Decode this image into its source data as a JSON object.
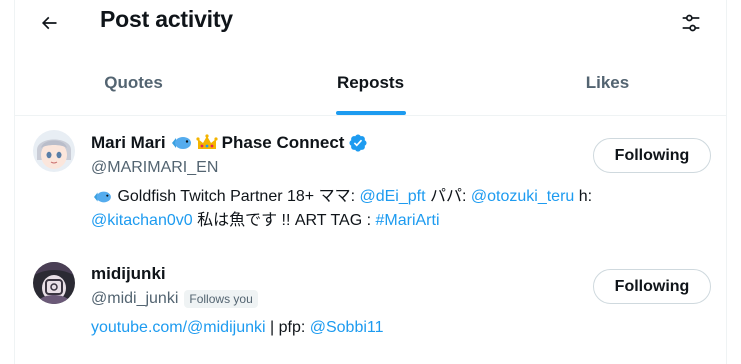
{
  "header": {
    "title": "Post activity",
    "back_icon": "arrow-left-icon",
    "filter_icon": "sliders-icon"
  },
  "tabs": [
    {
      "label": "Quotes",
      "active": false
    },
    {
      "label": "Reposts",
      "active": true
    },
    {
      "label": "Likes",
      "active": false
    }
  ],
  "users": [
    {
      "name": "Mari Mari",
      "name_suffix": "Phase Connect",
      "name_emojis": [
        "fish-emoji",
        "crown-emoji"
      ],
      "verified": true,
      "handle": "@MARIMARI_EN",
      "follow_label": "Following",
      "bio": {
        "t1": " Goldfish Twitch Partner 18+ ママ: ",
        "l1": "@dEi_pft",
        "t2": " パパ: ",
        "l2": "@otozuki_teru",
        "t3": " h:",
        "l3": "@kitachan0v0",
        "t4": " 私は魚です !! ART TAG : ",
        "l4": "#MariArti"
      }
    },
    {
      "name": "midijunki",
      "handle": "@midi_junki",
      "follows_you": "Follows you",
      "follow_label": "Following",
      "bio": {
        "l1": "youtube.com/@midijunki",
        "t1": " | pfp: ",
        "l2": "@Sobbi11"
      }
    }
  ],
  "colors": {
    "accent": "#1d9bf0",
    "text": "#0f1419",
    "secondary": "#536471",
    "border": "#eff3f4"
  }
}
